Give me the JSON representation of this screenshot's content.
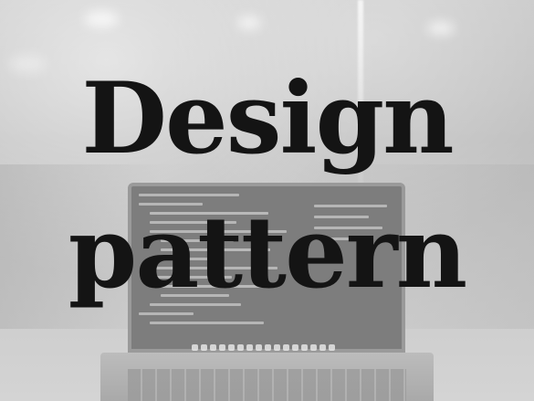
{
  "headline": {
    "line_1": "Design",
    "line_2": "pattern"
  },
  "colors": {
    "headline_text": "#141414",
    "background": "#d9d9d9"
  },
  "background_image": {
    "subject": "laptop-with-code-editor"
  }
}
